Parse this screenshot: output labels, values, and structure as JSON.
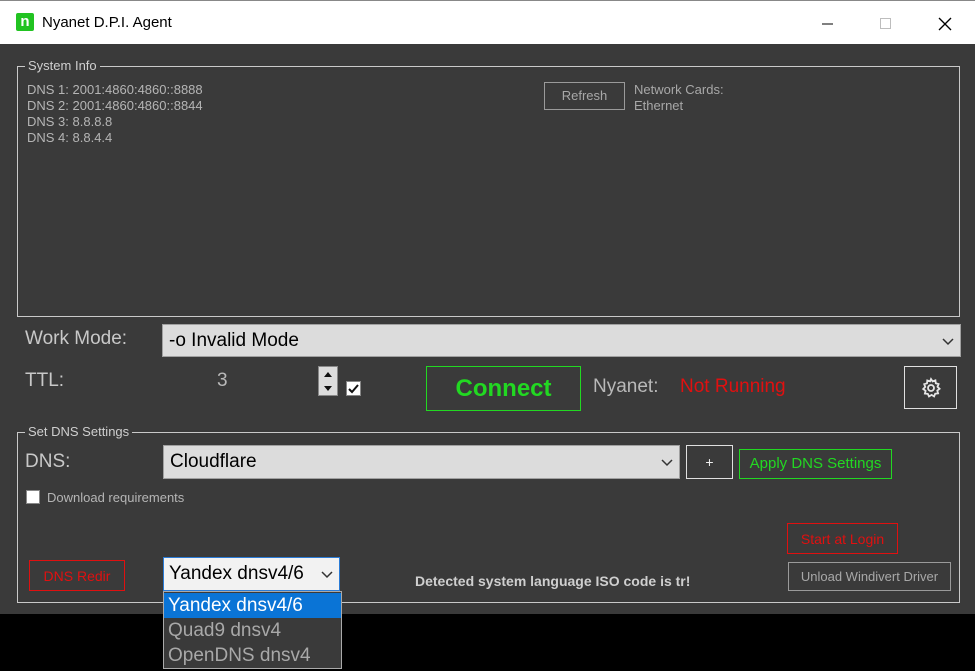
{
  "window": {
    "title": "Nyanet D.P.I. Agent",
    "logo_letter": "n",
    "accent": "#21c321"
  },
  "system_info": {
    "legend": "System Info",
    "dns_lines": [
      "DNS 1: 2001:4860:4860::8888",
      "DNS 2: 2001:4860:4860::8844",
      "DNS 3: 8.8.8.8",
      "DNS 4: 8.8.4.4"
    ],
    "refresh_label": "Refresh",
    "network_cards_label": "Network Cards:",
    "network_cards": [
      "Ethernet"
    ]
  },
  "work_mode": {
    "label": "Work Mode:",
    "value": "-o Invalid Mode"
  },
  "ttl": {
    "label": "TTL:",
    "value": "3",
    "checked": true
  },
  "connect": {
    "label": "Connect",
    "color": "#22d822"
  },
  "status": {
    "label": "Nyanet:",
    "value": "Not Running",
    "color": "#e01010"
  },
  "settings_icon": "gear-icon",
  "dns_settings": {
    "legend": "Set DNS Settings",
    "dns_label": "DNS:",
    "dns_value": "Cloudflare",
    "add_label": "+",
    "apply_label": "Apply DNS Settings",
    "download_requirements_label": "Download requirements",
    "start_at_login_label": "Start at Login",
    "dns_redir_label": "DNS Redir",
    "dns_redir_value": "Yandex dnsv4/6",
    "dns_redir_options": [
      "Yandex dnsv4/6",
      "Quad9 dnsv4",
      "OpenDNS dnsv4"
    ],
    "language_note": "Detected system language ISO code is tr!",
    "unload_driver_label": "Unload Windivert Driver"
  }
}
